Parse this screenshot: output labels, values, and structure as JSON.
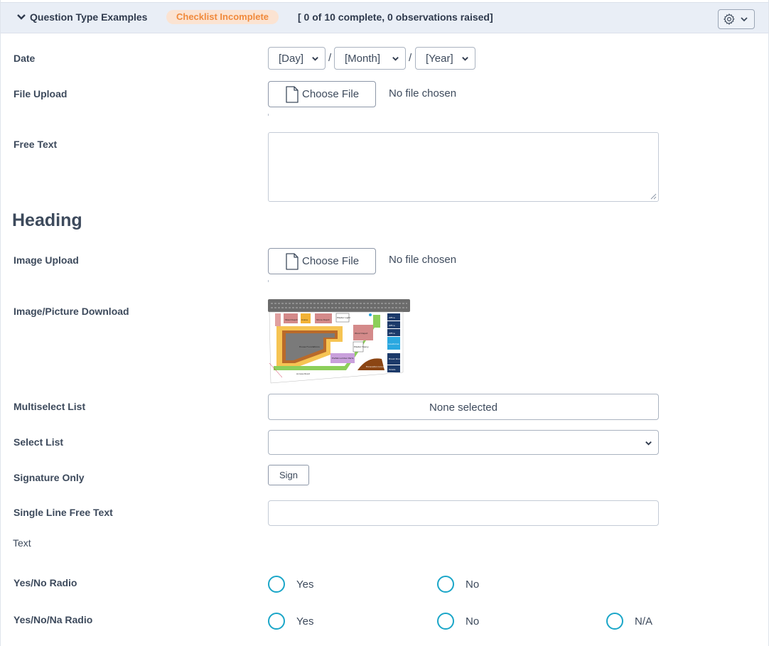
{
  "header": {
    "title": "Question Type Examples",
    "badge": "Checklist Incomplete",
    "summary": "[ 0 of 10 complete, 0 observations raised]"
  },
  "questions": {
    "date": {
      "label": "Date",
      "day": "[Day]",
      "month": "[Month]",
      "year": "[Year]",
      "separator": "/"
    },
    "file_upload": {
      "label": "File Upload",
      "button": "Choose File",
      "status": "No file chosen"
    },
    "free_text": {
      "label": "Free Text",
      "value": ""
    },
    "heading": "Heading",
    "image_upload": {
      "label": "Image Upload",
      "button": "Choose File",
      "status": "No file chosen"
    },
    "image_download": {
      "label": "Image/Picture Download"
    },
    "multiselect": {
      "label": "Multiselect List",
      "value": "None selected"
    },
    "select_list": {
      "label": "Select List",
      "value": ""
    },
    "signature": {
      "label": "Signature Only",
      "button": "Sign"
    },
    "single_line": {
      "label": "Single Line Free Text",
      "value": ""
    },
    "text": {
      "label": "Text"
    },
    "yes_no": {
      "label": "Yes/No Radio",
      "options": [
        "Yes",
        "No"
      ]
    },
    "yes_no_na": {
      "label": "Yes/No/Na Radio",
      "options": [
        "Yes",
        "No",
        "N/A"
      ]
    }
  },
  "site_plan": {
    "labels": [
      "Steel Depot",
      "Crane",
      "Stone Depot",
      "Plaster Light",
      "Wood Depot",
      "Plaster Heavy",
      "House Foundations",
      "Prefab Lumber Parts",
      "Excavation Ground",
      "Access Road",
      "Office",
      "Office",
      "Office",
      "Lavatories",
      "Break Room",
      "Toilets"
    ]
  },
  "colors": {
    "accent": "#1aa6c8",
    "badge_text": "#f08a3c",
    "badge_bg": "#fbe3d2",
    "header_bg": "#e9eef6"
  }
}
